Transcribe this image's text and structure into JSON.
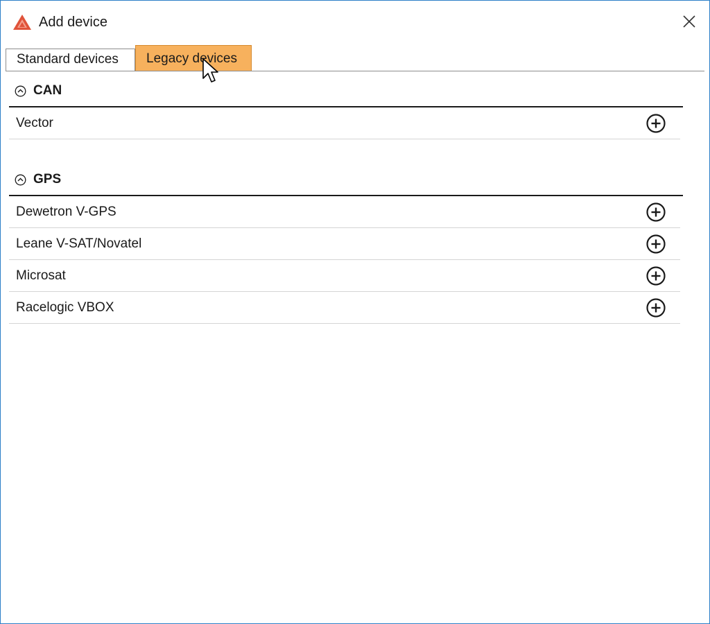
{
  "window": {
    "title": "Add device",
    "app_icon": "dewesoft-logo-icon",
    "close_icon": "close-icon",
    "border_color": "#2b7fc8"
  },
  "tabs": [
    {
      "label": "Standard devices",
      "selected": false
    },
    {
      "label": "Legacy devices",
      "selected": true
    }
  ],
  "accent_color": "#f7b15d",
  "sections": [
    {
      "title": "CAN",
      "expanded": true,
      "items": [
        {
          "label": "Vector"
        }
      ]
    },
    {
      "title": "GPS",
      "expanded": true,
      "items": [
        {
          "label": "Dewetron V-GPS"
        },
        {
          "label": "Leane V-SAT/Novatel"
        },
        {
          "label": "Microsat"
        },
        {
          "label": "Racelogic VBOX"
        }
      ]
    }
  ],
  "icons": {
    "collapse": "chevron-up-circle-icon",
    "add": "plus-circle-icon"
  }
}
